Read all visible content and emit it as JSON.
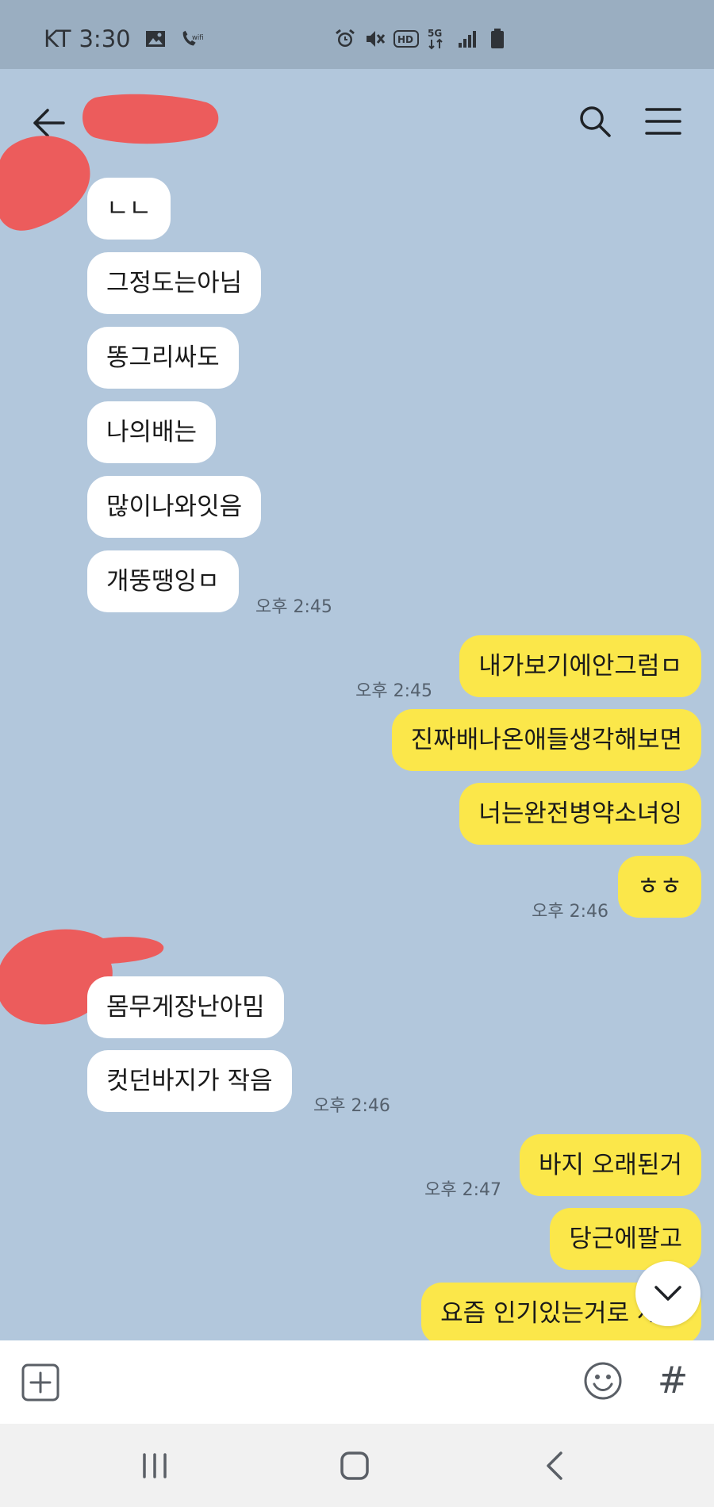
{
  "status_bar": {
    "carrier": "KT",
    "time": "3:30",
    "left_icons": [
      "image-icon",
      "wifi-call-icon"
    ],
    "right_icons": [
      "alarm-icon",
      "mute-icon",
      "hd-icon",
      "5g-icon",
      "signal-icon",
      "battery-icon"
    ],
    "hd_label": "HD",
    "network_label": "5G"
  },
  "header": {
    "icons": [
      "back-arrow-icon",
      "search-icon",
      "menu-icon"
    ]
  },
  "messages": {
    "m1": "ㄴㄴ",
    "m2": "그정도는아님",
    "m3": "똥그리싸도",
    "m4": "나의배는",
    "m5": "많이나와잇음",
    "m6": "개뚱땡잉ㅁ",
    "t1": "오후 2:45",
    "m7": "내가보기에안그럼ㅁ",
    "t2": "오후 2:45",
    "m8": "진짜배나온애들생각해보면",
    "m9": "너는완전병약소녀잉",
    "m10": "ㅎㅎ",
    "t3": "오후 2:46",
    "m11": "몸무게장난아밈",
    "m12": "컷던바지가 작음",
    "t4": "오후 2:46",
    "m13": "바지 오래된거",
    "t5": "오후 2:47",
    "m14": "당근에팔고",
    "m15": "요즘 인기있는거로 새로"
  },
  "colors": {
    "background": "#b2c7dc",
    "incoming_bubble": "#ffffff",
    "outgoing_bubble": "#fbe74a",
    "redaction": "#ec5c5c"
  },
  "input_bar": {
    "icons": [
      "plus-icon",
      "emoji-icon",
      "hash-icon"
    ],
    "hash_label": "#"
  },
  "nav_bar": {
    "icons": [
      "recent-apps-icon",
      "home-icon",
      "back-icon"
    ]
  }
}
